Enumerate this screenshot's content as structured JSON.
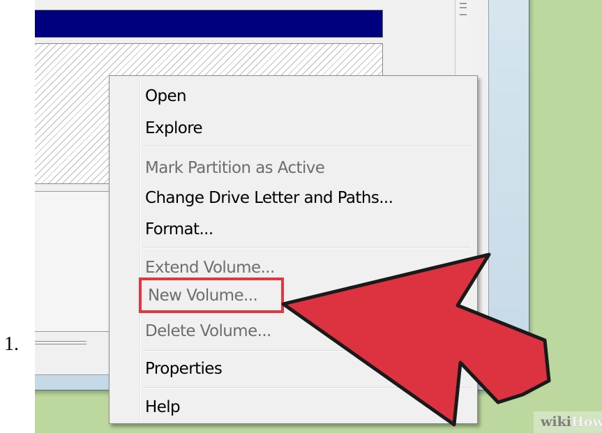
{
  "list_marker": "1.",
  "context_menu": {
    "items": [
      {
        "label": "Open",
        "enabled": true
      },
      {
        "label": "Explore",
        "enabled": true
      },
      {
        "label": "Mark Partition as Active",
        "enabled": false
      },
      {
        "label": "Change Drive Letter and Paths...",
        "enabled": true
      },
      {
        "label": "Format...",
        "enabled": true
      },
      {
        "label": "Extend Volume...",
        "enabled": false
      },
      {
        "label": "New Volume...",
        "enabled": false,
        "highlighted": true
      },
      {
        "label": "Delete Volume...",
        "enabled": false
      },
      {
        "label": "Properties",
        "enabled": true
      },
      {
        "label": "Help",
        "enabled": true
      }
    ]
  },
  "watermark": {
    "part1": "wiki",
    "part2": "How"
  },
  "colors": {
    "disk_header": "#00007f",
    "annotation_red": "#e0383e",
    "arrow_fill": "#dd3340",
    "background_green": "#bcd89e",
    "menu_background": "#f0f0f0",
    "disabled_text": "#6d6d6d"
  },
  "icons": {
    "pointer_arrow": "big-red-arrow-icon",
    "scroll_grip": "scrollbar-grip-icon"
  }
}
